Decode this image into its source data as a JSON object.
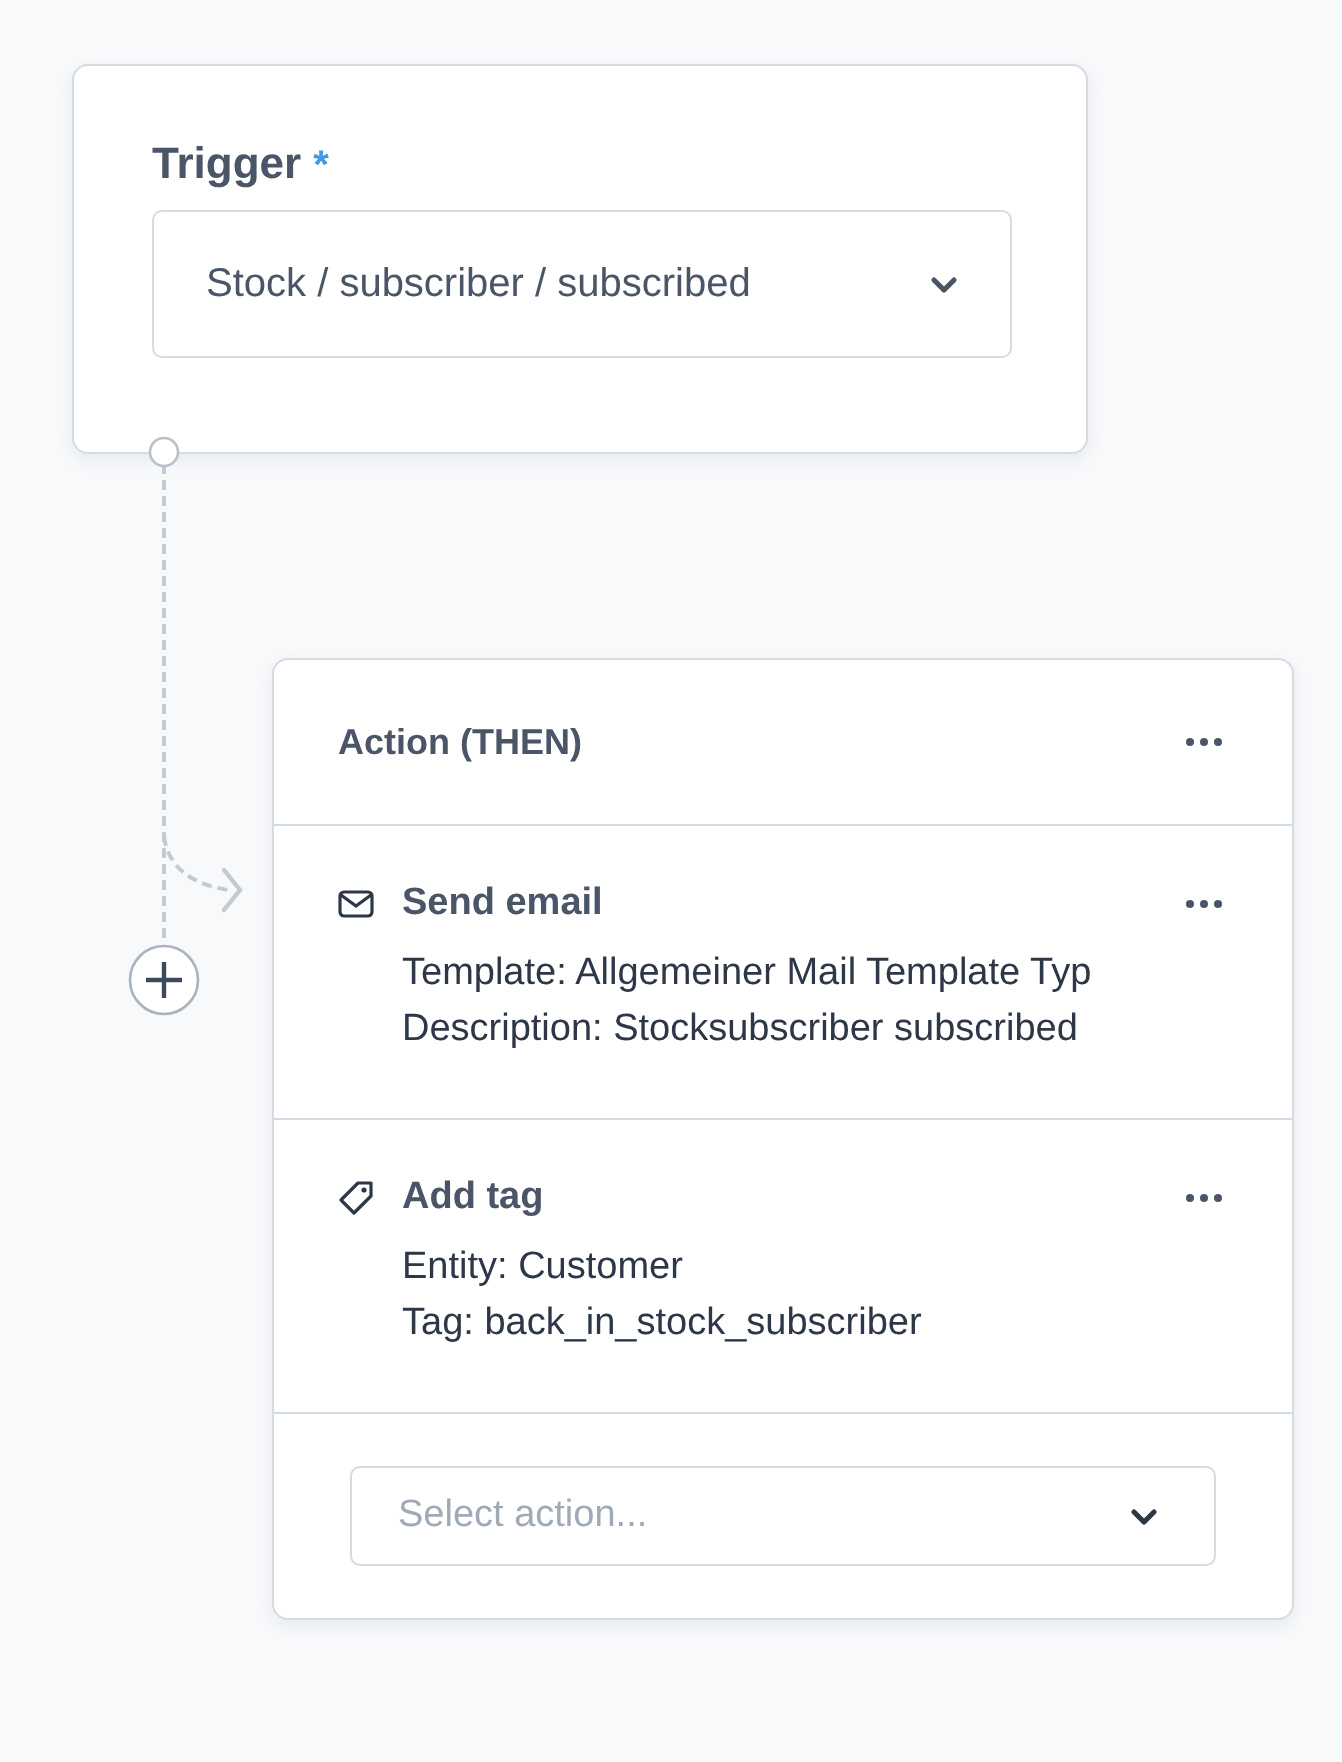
{
  "trigger": {
    "label": "Trigger",
    "required_mark": "*",
    "value": "Stock / subscriber / subscribed"
  },
  "action_card": {
    "title": "Action (THEN)",
    "actions": [
      {
        "kind": "email",
        "title": "Send email",
        "details": [
          "Template: Allgemeiner Mail Template Typ",
          "Description: Stocksubscriber subscribed"
        ]
      },
      {
        "kind": "tag",
        "title": "Add tag",
        "details": [
          "Entity: Customer",
          "Tag: back_in_stock_subscriber"
        ]
      }
    ],
    "select": {
      "placeholder": "Select action..."
    }
  }
}
